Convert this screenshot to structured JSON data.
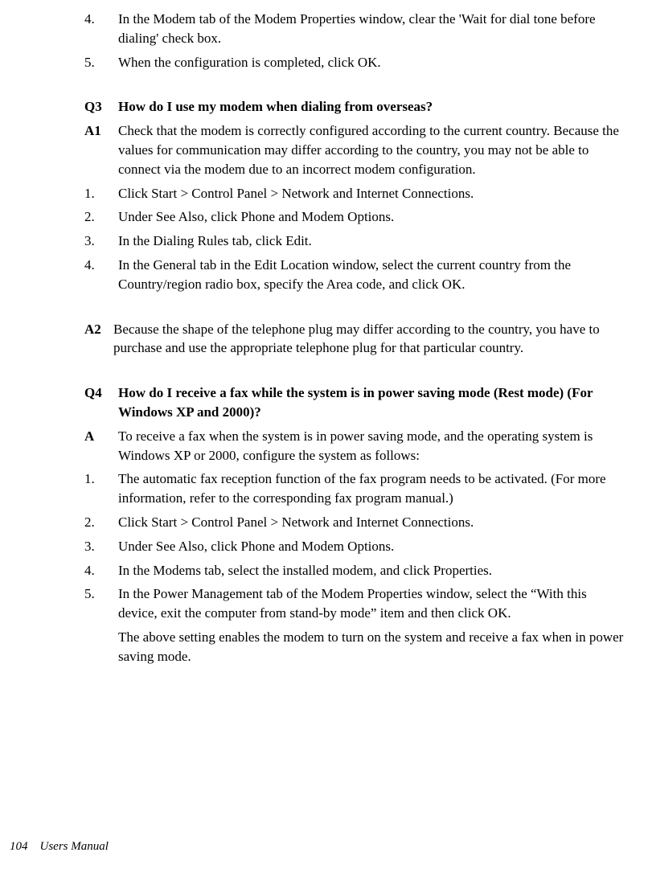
{
  "sec1": {
    "items": [
      {
        "label": "4.",
        "text": "In the Modem tab of the Modem Properties window, clear the 'Wait for dial tone before dialing' check box."
      },
      {
        "label": "5.",
        "text": "When the configuration is completed, click OK."
      }
    ]
  },
  "sec2": {
    "q_label": "Q3",
    "q_text": "How do I use my modem when dialing from overseas?",
    "a1_label": "A1",
    "a1_text": "Check that the modem is correctly configured according to the current country. Because the values for communication may differ according to the country, you may not be able to connect via the modem due to an incorrect modem configuration.",
    "steps": [
      {
        "label": "1.",
        "text": "Click Start > Control Panel > Network and Internet Connections."
      },
      {
        "label": "2.",
        "text": "Under See Also, click Phone and Modem Options."
      },
      {
        "label": "3.",
        "text": "In the Dialing Rules tab, click Edit."
      },
      {
        "label": "4.",
        "text": "In the General tab in the Edit Location window, select the current country from the Country/region radio box, specify the Area code, and click OK."
      }
    ],
    "a2_label": "A2",
    "a2_text": "Because the shape of the telephone plug may differ according to the country, you have to purchase and use the appropriate telephone plug for that particular country."
  },
  "sec3": {
    "q_label": "Q4",
    "q_text": "How do I receive a fax while the system is in power saving mode (Rest mode) (For Windows XP and 2000)?",
    "a_label": "A",
    "a_text": "To receive a fax when the system is in power saving mode, and the operating system is Windows XP or 2000, configure the system as follows:",
    "steps": [
      {
        "label": "1.",
        "text": "The automatic fax reception function of the fax program needs to be activated. (For more information, refer to the corresponding fax program manual.)"
      },
      {
        "label": "2.",
        "text": "Click Start > Control Panel > Network and Internet Connections."
      },
      {
        "label": "3.",
        "text": "Under See Also, click Phone and Modem Options."
      },
      {
        "label": "4.",
        "text": "In the Modems tab, select the installed modem, and click Properties."
      },
      {
        "label": "5.",
        "text": "In the Power Management tab of the Modem Properties window, select the “With this device, exit the computer from stand-by mode” item and then click OK."
      }
    ],
    "tail": "The above setting enables the modem to turn on the system and receive a fax when in power saving mode."
  },
  "footer": {
    "page": "104",
    "title": "Users Manual"
  }
}
